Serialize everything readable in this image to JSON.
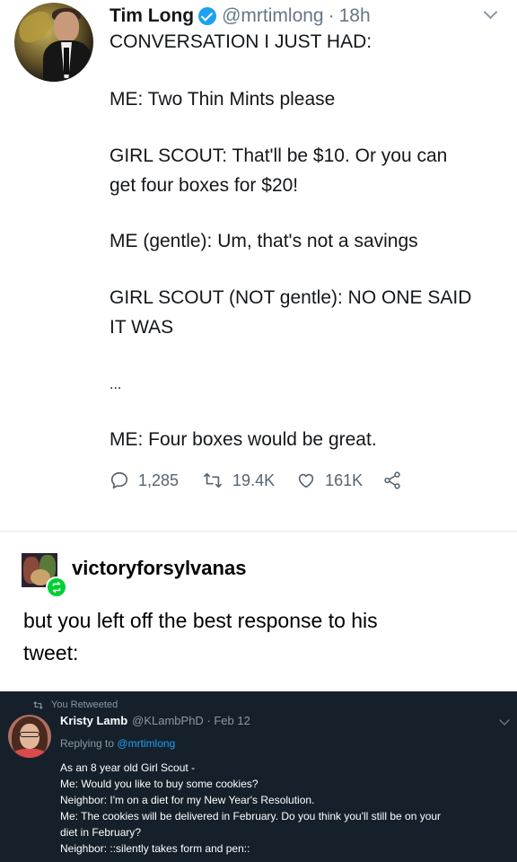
{
  "tweet1": {
    "name": "Tim Long",
    "handle": "@mrtimlong",
    "separator": "·",
    "time": "18h",
    "lines": [
      "CONVERSATION I JUST HAD:",
      "ME: Two Thin Mints please",
      "GIRL SCOUT: That'll be $10. Or you can",
      "get four boxes for $20!",
      "ME (gentle): Um, that's not a savings",
      "GIRL SCOUT (NOT gentle): NO ONE SAID",
      "IT WAS",
      "...",
      "ME: Four boxes would be great."
    ],
    "actions": {
      "replies": "1,285",
      "retweets": "19.4K",
      "likes": "161K"
    },
    "icons": [
      "verified-icon",
      "chevron-down-icon",
      "reply-icon",
      "retweet-icon",
      "like-icon",
      "share-icon"
    ]
  },
  "tumblr": {
    "username": "victoryforsylvanas",
    "text_lines": [
      "but you left off the best response to his",
      "tweet:"
    ],
    "accent": "#00cf35"
  },
  "tweet2": {
    "retweet_label": "You Retweeted",
    "name": "Kristy Lamb",
    "meta": "@KLambPhD · Feb 12",
    "reply_prefix": "Replying to",
    "reply_handle": "@mrtimlong",
    "lines": [
      "As an 8 year old Girl Scout -",
      "Me: Would you like to buy some cookies?",
      "Neighbor: I'm on a diet for my New Year's Resolution.",
      "Me: The cookies will be delivered in February. Do you think you'll still be on your",
      "diet in February?",
      "Neighbor: ::silently takes form and pen::"
    ],
    "background": "#15202b"
  },
  "colors": {
    "twitter_blue": "#1da1f2",
    "muted_text": "#657786",
    "dark_bg": "#15202b"
  }
}
